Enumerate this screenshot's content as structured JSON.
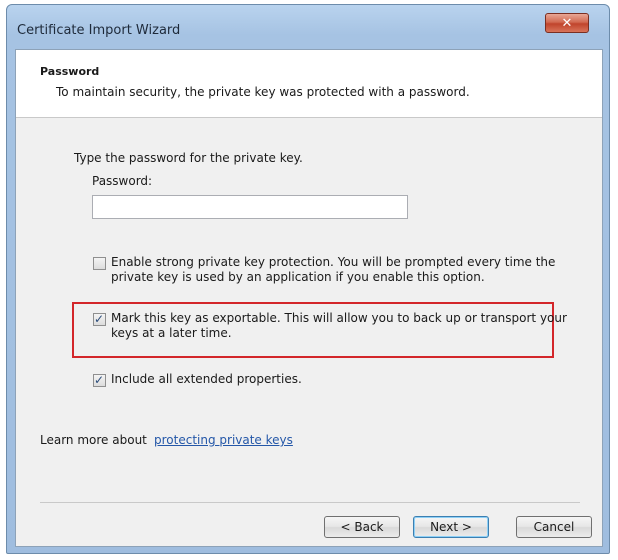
{
  "window": {
    "title": "Certificate Import Wizard",
    "close_glyph": "✕"
  },
  "header": {
    "title": "Password",
    "description": "To maintain security, the private key was protected with a password."
  },
  "body": {
    "prompt": "Type the password for the private key.",
    "password_label": "Password:",
    "password_value": "",
    "options": [
      {
        "line1": "Enable strong private key protection. You will be prompted every time the",
        "line2": "private key is used by an application if you enable this option.",
        "checked": false
      },
      {
        "line1": "Mark this key as exportable. This will allow you to back up or transport your",
        "line2": "keys at a later time.",
        "checked": true,
        "highlighted": true
      },
      {
        "line1": "Include all extended properties.",
        "checked": true
      }
    ],
    "check_glyph": "✓",
    "learn_more_text": "Learn more about ",
    "learn_more_link": "protecting private keys"
  },
  "footer": {
    "back_label": "< Back",
    "next_label": "Next >",
    "cancel_label": "Cancel"
  },
  "colors": {
    "highlight_border": "#d3262a",
    "link": "#2457a8",
    "close_button": "#c0442c"
  }
}
